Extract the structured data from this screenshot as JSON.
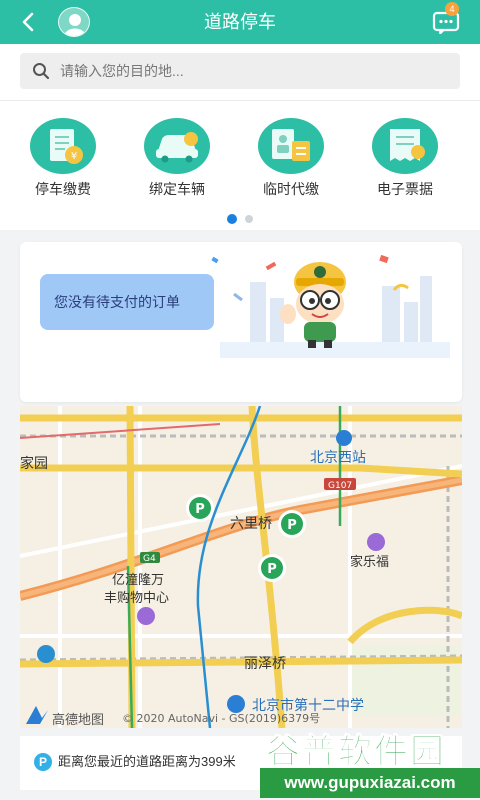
{
  "header": {
    "title": "道路停车",
    "badge": "4"
  },
  "search": {
    "placeholder": "请输入您的目的地..."
  },
  "menu": {
    "items": [
      {
        "label": "停车缴费",
        "icon": "parking-fee-icon"
      },
      {
        "label": "绑定车辆",
        "icon": "bind-car-icon"
      },
      {
        "label": "临时代缴",
        "icon": "temporary-pay-icon"
      },
      {
        "label": "电子票据",
        "icon": "e-receipt-icon"
      }
    ],
    "page_index": 0,
    "page_count": 2
  },
  "orders": {
    "message": "您没有待支付的订单"
  },
  "map": {
    "labels": {
      "jiayuan": "家园",
      "beijing_west": "北京西站",
      "g107": "G107",
      "liulicun": "六里桥",
      "jialefu": "家乐福",
      "g4": "G4",
      "yitong_1": "亿潼隆万",
      "yitong_2": "丰购物中心",
      "lizeqiao": "丽泽桥",
      "school": "北京市第十二中学",
      "logo": "高德地图",
      "copyright": "© 2020 AutoNavi - GS(2019)6379号"
    }
  },
  "bottom": {
    "text": "距离您最近的道路距离为399米"
  },
  "watermark": {
    "title": "谷普软件园",
    "url": "www.gupuxiazai.com"
  },
  "colors": {
    "primary": "#2dbfa5",
    "accent": "#1a7fe0",
    "badge": "#f7a23a"
  }
}
